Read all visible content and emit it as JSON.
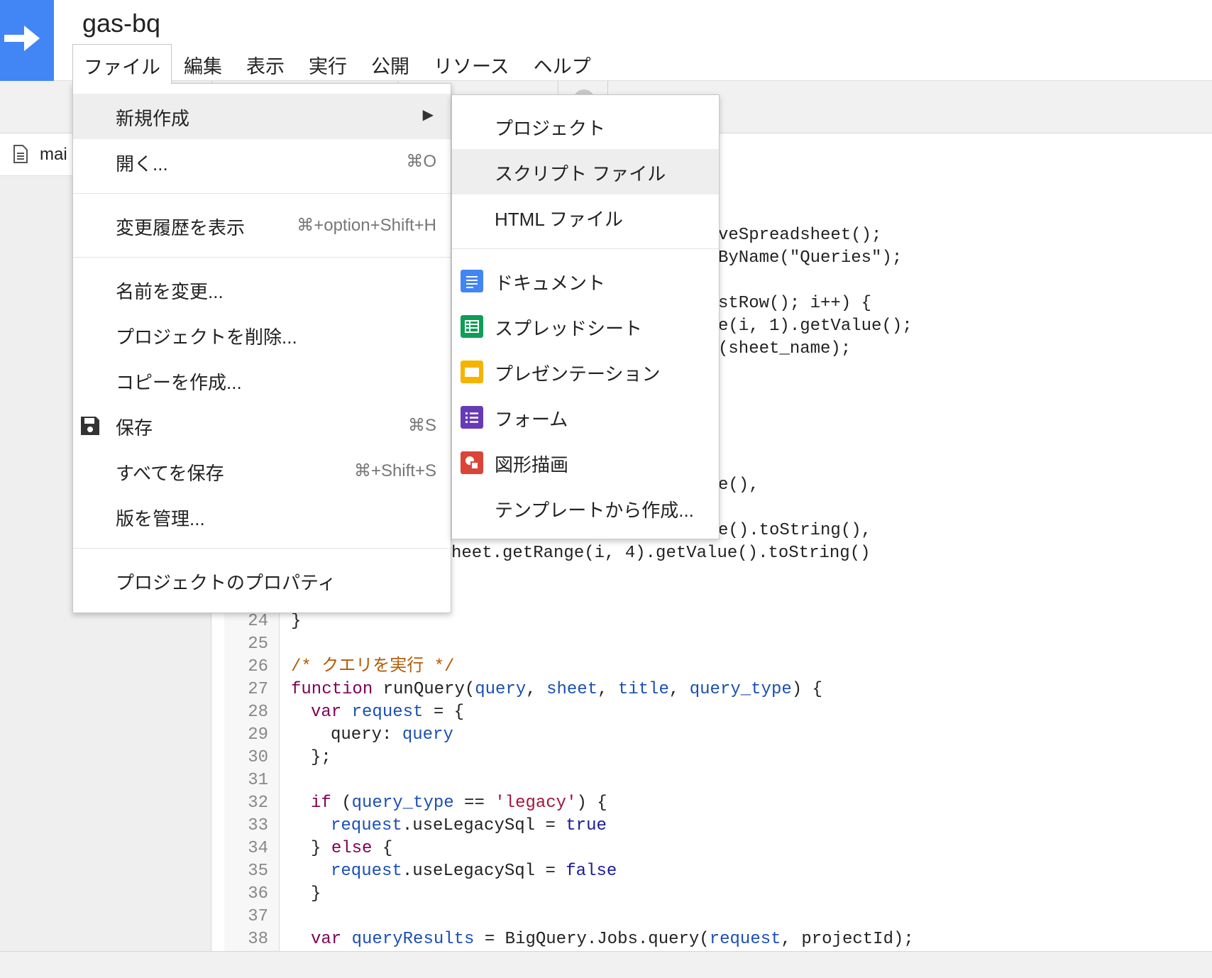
{
  "app": {
    "title": "gas-bq",
    "logo_icon": "arrow-right-icon",
    "brand_color": "#4285f4"
  },
  "menubar": [
    {
      "label": "ファイル"
    },
    {
      "label": "編集"
    },
    {
      "label": "表示"
    },
    {
      "label": "実行"
    },
    {
      "label": "公開"
    },
    {
      "label": "リソース"
    },
    {
      "label": "ヘルプ"
    }
  ],
  "sidebar": {
    "file_name": "mai"
  },
  "file_menu": {
    "new": {
      "label": "新規作成",
      "arrow": "▶"
    },
    "open": {
      "label": "開く...",
      "shortcut": "⌘O"
    },
    "history": {
      "label": "変更履歴を表示",
      "shortcut": "⌘+option+Shift+H"
    },
    "rename": {
      "label": "名前を変更..."
    },
    "delete": {
      "label": "プロジェクトを削除..."
    },
    "copy": {
      "label": "コピーを作成..."
    },
    "save": {
      "label": "保存",
      "shortcut": "⌘S",
      "icon": "floppy-disk-icon"
    },
    "save_all": {
      "label": "すべてを保存",
      "shortcut": "⌘+Shift+S"
    },
    "versions": {
      "label": "版を管理..."
    },
    "properties": {
      "label": "プロジェクトのプロパティ"
    }
  },
  "new_menu": {
    "project": {
      "label": "プロジェクト"
    },
    "script_file": {
      "label": "スクリプト ファイル"
    },
    "html_file": {
      "label": "HTML ファイル"
    },
    "document": {
      "label": "ドキュメント",
      "icon": "google-docs-icon",
      "color": "#4285f4"
    },
    "spreadsheet": {
      "label": "スプレッドシート",
      "icon": "google-sheets-icon",
      "color": "#0f9d58"
    },
    "presentation": {
      "label": "プレゼンテーション",
      "icon": "google-slides-icon",
      "color": "#f4b400"
    },
    "form": {
      "label": "フォーム",
      "icon": "google-forms-icon",
      "color": "#673ab7"
    },
    "drawing": {
      "label": "図形描画",
      "icon": "google-drawings-icon",
      "color": "#db4437"
    },
    "template": {
      "label": "テンプレートから作成..."
    }
  },
  "code": {
    "partial_lines": [
      {
        "text": "veSpreadsheet();"
      },
      {
        "text": "ByName(\"Queries\");"
      },
      {
        "text": "stRow(); i++) {"
      },
      {
        "text": "e(i, 1).getValue();"
      },
      {
        "text": "(sheet_name);"
      },
      {
        "text": "e(),"
      },
      {
        "text": "e().toString(),"
      },
      {
        "text": "heet.getRange(i, 4).getValue().toString()"
      }
    ],
    "line_numbers": [
      "24",
      "25",
      "26",
      "27",
      "28",
      "29",
      "30",
      "31",
      "32",
      "33",
      "34",
      "35",
      "36",
      "37",
      "38"
    ],
    "lines": {
      "l24": "}",
      "l26": "/* クエリを実行 */",
      "l27_kw": "function",
      "l27_name": " runQuery(",
      "l27_p1": "query",
      "l27_c1": ", ",
      "l27_p2": "sheet",
      "l27_c2": ", ",
      "l27_p3": "title",
      "l27_c3": ", ",
      "l27_p4": "query_type",
      "l27_end": ") {",
      "l28_kw": "var",
      "l28_v": " request",
      "l28_end": " = {",
      "l29_a": "query: ",
      "l29_b": "query",
      "l30": "};",
      "l32_kw": "if",
      "l32_a": " (",
      "l32_v": "query_type",
      "l32_b": " == ",
      "l32_s": "'legacy'",
      "l32_end": ") {",
      "l33_v": "request",
      "l33_a": ".useLegacySql = ",
      "l33_b": "true",
      "l34_a": "} ",
      "l34_kw": "else",
      "l34_b": " {",
      "l35_v": "request",
      "l35_a": ".useLegacySql = ",
      "l35_b": "false",
      "l36": "}",
      "l38_kw": "var",
      "l38_v": " queryResults",
      "l38_a": " = BigQuery.Jobs.query(",
      "l38_v2": "request",
      "l38_end": ", projectId);"
    }
  }
}
